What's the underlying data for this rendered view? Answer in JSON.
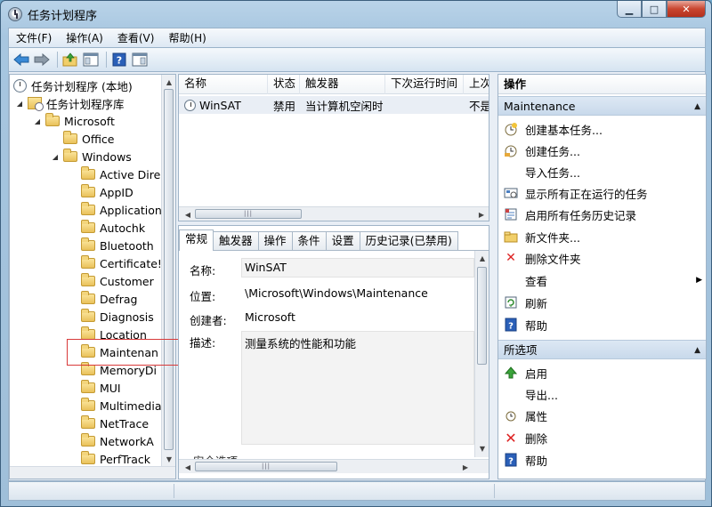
{
  "window": {
    "title": "任务计划程序"
  },
  "menu": [
    "文件(F)",
    "操作(A)",
    "查看(V)",
    "帮助(H)"
  ],
  "tree": {
    "root": "任务计划程序 (本地)",
    "library": "任务计划程序库",
    "microsoft": "Microsoft",
    "office": "Office",
    "windows": "Windows",
    "folders": [
      "Active Dire",
      "AppID",
      "Application",
      "Autochk",
      "Bluetooth",
      "Certificate!",
      "Customer",
      "Defrag",
      "Diagnosis",
      "Location",
      "Maintenan",
      "MemoryDi",
      "MUI",
      "Multimedia",
      "NetTrace",
      "NetworkA",
      "PerfTrack"
    ]
  },
  "task_list": {
    "columns": [
      "名称",
      "状态",
      "触发器",
      "下次运行时间",
      "上次"
    ],
    "rows": [
      {
        "name": "WinSAT",
        "status": "禁用",
        "trigger": "当计算机空闲时",
        "next_run": "",
        "last_run": "不是"
      }
    ]
  },
  "detail": {
    "tabs": [
      "常规",
      "触发器",
      "操作",
      "条件",
      "设置",
      "历史记录(已禁用)"
    ],
    "labels": {
      "name": "名称:",
      "location": "位置:",
      "author": "创建者:",
      "description": "描述:",
      "security": "安全选项"
    },
    "values": {
      "name": "WinSAT",
      "location": "\\Microsoft\\Windows\\Maintenance",
      "author": "Microsoft",
      "description": "测量系统的性能和功能"
    }
  },
  "actions": {
    "title": "操作",
    "section1": "Maintenance",
    "items1": [
      {
        "label": "创建基本任务...",
        "icon": "create-basic-task-icon"
      },
      {
        "label": "创建任务...",
        "icon": "create-task-icon"
      },
      {
        "label": "导入任务...",
        "icon": ""
      },
      {
        "label": "显示所有正在运行的任务",
        "icon": "running-tasks-icon"
      },
      {
        "label": "启用所有任务历史记录",
        "icon": "history-icon"
      },
      {
        "label": "新文件夹...",
        "icon": "new-folder-icon"
      },
      {
        "label": "删除文件夹",
        "icon": "delete-icon"
      },
      {
        "label": "查看",
        "icon": ""
      },
      {
        "label": "刷新",
        "icon": "refresh-icon"
      },
      {
        "label": "帮助",
        "icon": "help-icon"
      }
    ],
    "section2": "所选项",
    "items2": [
      {
        "label": "启用",
        "icon": "enable-icon"
      },
      {
        "label": "导出...",
        "icon": ""
      },
      {
        "label": "属性",
        "icon": "properties-icon"
      },
      {
        "label": "删除",
        "icon": "delete-icon"
      },
      {
        "label": "帮助",
        "icon": "help-icon"
      }
    ]
  },
  "colors": {
    "accent": "#c8d9eb",
    "highlight_box": "#d83a3a",
    "selected_row": "#e9eef5"
  }
}
